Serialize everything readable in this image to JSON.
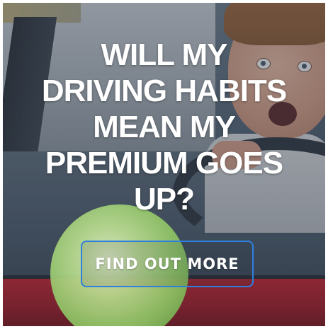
{
  "ad": {
    "headline_lines": [
      "WILL MY",
      "DRIVING HABITS",
      "MEAN MY",
      "PREMIUM GOES",
      "UP?"
    ],
    "cta_label": "FIND OUT MORE"
  },
  "colors": {
    "cta_border": "#2f7fe0",
    "text": "#ffffff",
    "car_red": "#c42330",
    "ball_green": "#8fc565"
  }
}
